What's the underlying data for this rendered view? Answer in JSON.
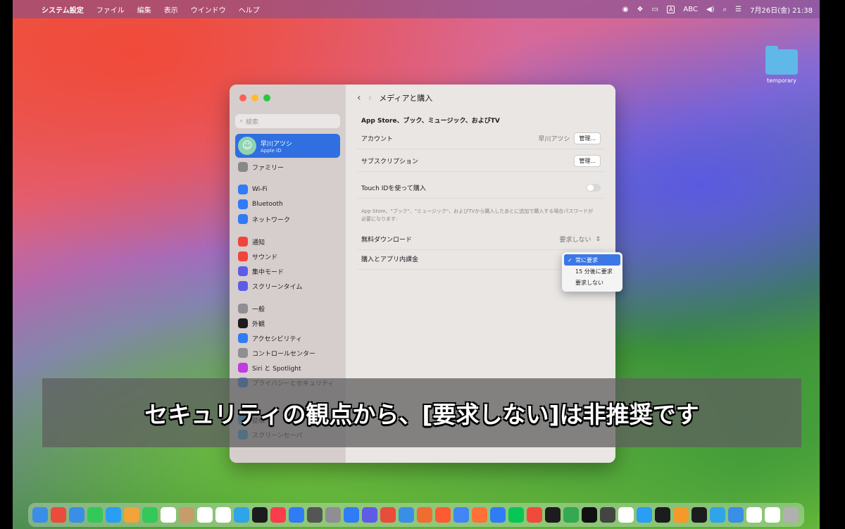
{
  "menubar": {
    "app": "システム設定",
    "items": [
      "ファイル",
      "編集",
      "表示",
      "ウインドウ",
      "ヘルプ"
    ],
    "input_badge": "A",
    "input_label": "ABC",
    "datetime": "7月26日(金)  21:38"
  },
  "desktop": {
    "folder_label": "temporary"
  },
  "sidebar": {
    "search_placeholder": "検索",
    "account": {
      "name": "早川アツシ",
      "sub": "Apple ID"
    },
    "items": [
      {
        "label": "ファミリー",
        "color": "#888888"
      },
      {
        "label": "Wi-Fi",
        "color": "#2f7cf6"
      },
      {
        "label": "Bluetooth",
        "color": "#2f7cf6"
      },
      {
        "label": "ネットワーク",
        "color": "#2f7cf6"
      },
      {
        "label": "通知",
        "color": "#f0453a"
      },
      {
        "label": "サウンド",
        "color": "#f0453a"
      },
      {
        "label": "集中モード",
        "color": "#5e5ce6"
      },
      {
        "label": "スクリーンタイム",
        "color": "#5e5ce6"
      },
      {
        "label": "一般",
        "color": "#8e8e93"
      },
      {
        "label": "外観",
        "color": "#1c1c1e"
      },
      {
        "label": "アクセシビリティ",
        "color": "#2f7cf6"
      },
      {
        "label": "コントロールセンター",
        "color": "#8e8e93"
      },
      {
        "label": "Siri と Spotlight",
        "color": "#c03ce0"
      },
      {
        "label": "プライバシーとセキュリティ",
        "color": "#2f7cf6"
      },
      {
        "label": "壁紙",
        "color": "#2fa4e6"
      },
      {
        "label": "スクリーンセーバ",
        "color": "#2fa4e6"
      }
    ]
  },
  "main": {
    "title": "メディアと購入",
    "section": "App Store、ブック、ミュージック、およびTV",
    "account_label": "アカウント",
    "account_value": "早川アツシ",
    "manage_label": "管理...",
    "subscription_label": "サブスクリプション",
    "touchid_label": "Touch IDを使って購入",
    "help_text": "App Store、\"ブック\"、\"ミュージック\"、およびTVから購入したあとに追加で購入する場合パスワードが必要になります:",
    "free_download_label": "無料ダウンロード",
    "free_download_value": "要求しない",
    "purchase_label": "購入とアプリ内課金"
  },
  "popup": {
    "options": [
      "常に要求",
      "15 分後に要求",
      "要求しない"
    ],
    "selected_index": 0
  },
  "caption": "セキュリティの観点から、[要求しない]は非推奨です"
}
